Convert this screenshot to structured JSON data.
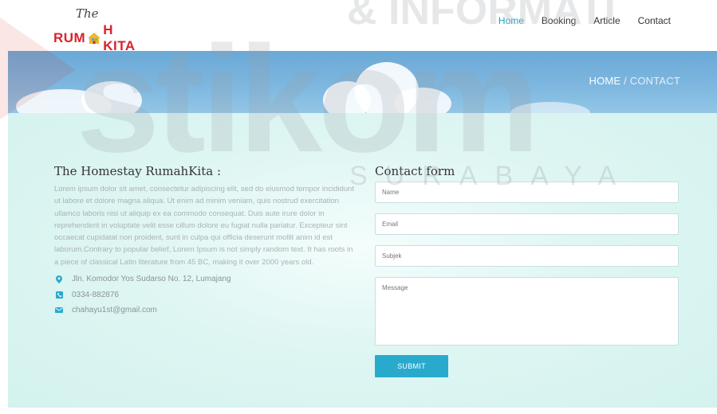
{
  "header": {
    "logo": {
      "the": "The",
      "main_left": "RUM",
      "main_right": "H KITA"
    },
    "nav": [
      {
        "label": "Home",
        "active": true
      },
      {
        "label": "Booking",
        "active": false
      },
      {
        "label": "Article",
        "active": false
      },
      {
        "label": "Contact",
        "active": false
      }
    ]
  },
  "banner": {
    "breadcrumb": {
      "home": "HOME",
      "separator": " / ",
      "current": "CONTACT"
    }
  },
  "about": {
    "title": "The Homestay RumahKita :",
    "text": "Lorem ipsum dolor sit amet, consectetur adipiscing elit, sed do eiusmod tempor incididunt ut labore et dolore magna aliqua. Ut enim ad minim veniam, quis nostrud exercitation ullamco laboris nisi ut aliquip ex ea commodo consequat. Duis aute irure dolor in reprehenderit in voluptate velit esse cillum dolore eu fugiat nulla pariatur. Excepteur sint occaecat cupidatat non proident, sunt in culpa qui officia deserunt mollit anim id est laborum.Contrary to popular belief, Lorem Ipsum is not simply random text. It has roots in a piece of classical Latin literature from 45 BC, making it over 2000 years old.",
    "address": "Jln. Komodor Yos Sudarso No. 12, Lumajang",
    "phone": "0334-882876",
    "email": "chahayu1st@gmail.com",
    "icons": {
      "address": "map-marker-icon",
      "phone": "phone-icon",
      "email": "envelope-icon"
    },
    "icon_color": "#29aacd"
  },
  "contact_form": {
    "title": "Contact form",
    "name_placeholder": "Name",
    "email_placeholder": "Email",
    "subject_placeholder": "Subjek",
    "message_placeholder": "Message",
    "submit_label": "SUBMIT"
  },
  "watermark": {
    "top_text": "& INFORMATI",
    "main_text": "stikom",
    "sub_text": "SURABAYA"
  },
  "colors": {
    "accent": "#29aacd",
    "nav_active": "#1e9fc4",
    "logo_red": "#d9232d"
  }
}
